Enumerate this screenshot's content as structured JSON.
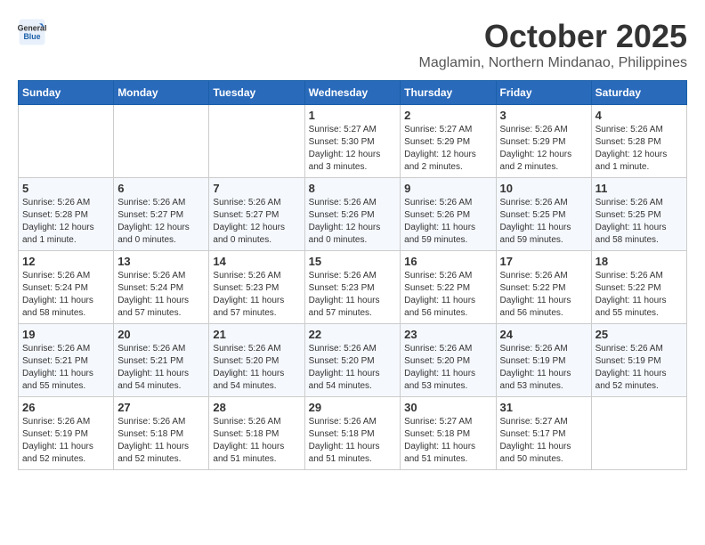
{
  "header": {
    "logo_line1": "General",
    "logo_line2": "Blue",
    "month": "October 2025",
    "location": "Maglamin, Northern Mindanao, Philippines"
  },
  "weekdays": [
    "Sunday",
    "Monday",
    "Tuesday",
    "Wednesday",
    "Thursday",
    "Friday",
    "Saturday"
  ],
  "weeks": [
    [
      {
        "day": "",
        "sunrise": "",
        "sunset": "",
        "daylight": ""
      },
      {
        "day": "",
        "sunrise": "",
        "sunset": "",
        "daylight": ""
      },
      {
        "day": "",
        "sunrise": "",
        "sunset": "",
        "daylight": ""
      },
      {
        "day": "1",
        "sunrise": "Sunrise: 5:27 AM",
        "sunset": "Sunset: 5:30 PM",
        "daylight": "Daylight: 12 hours and 3 minutes."
      },
      {
        "day": "2",
        "sunrise": "Sunrise: 5:27 AM",
        "sunset": "Sunset: 5:29 PM",
        "daylight": "Daylight: 12 hours and 2 minutes."
      },
      {
        "day": "3",
        "sunrise": "Sunrise: 5:26 AM",
        "sunset": "Sunset: 5:29 PM",
        "daylight": "Daylight: 12 hours and 2 minutes."
      },
      {
        "day": "4",
        "sunrise": "Sunrise: 5:26 AM",
        "sunset": "Sunset: 5:28 PM",
        "daylight": "Daylight: 12 hours and 1 minute."
      }
    ],
    [
      {
        "day": "5",
        "sunrise": "Sunrise: 5:26 AM",
        "sunset": "Sunset: 5:28 PM",
        "daylight": "Daylight: 12 hours and 1 minute."
      },
      {
        "day": "6",
        "sunrise": "Sunrise: 5:26 AM",
        "sunset": "Sunset: 5:27 PM",
        "daylight": "Daylight: 12 hours and 0 minutes."
      },
      {
        "day": "7",
        "sunrise": "Sunrise: 5:26 AM",
        "sunset": "Sunset: 5:27 PM",
        "daylight": "Daylight: 12 hours and 0 minutes."
      },
      {
        "day": "8",
        "sunrise": "Sunrise: 5:26 AM",
        "sunset": "Sunset: 5:26 PM",
        "daylight": "Daylight: 12 hours and 0 minutes."
      },
      {
        "day": "9",
        "sunrise": "Sunrise: 5:26 AM",
        "sunset": "Sunset: 5:26 PM",
        "daylight": "Daylight: 11 hours and 59 minutes."
      },
      {
        "day": "10",
        "sunrise": "Sunrise: 5:26 AM",
        "sunset": "Sunset: 5:25 PM",
        "daylight": "Daylight: 11 hours and 59 minutes."
      },
      {
        "day": "11",
        "sunrise": "Sunrise: 5:26 AM",
        "sunset": "Sunset: 5:25 PM",
        "daylight": "Daylight: 11 hours and 58 minutes."
      }
    ],
    [
      {
        "day": "12",
        "sunrise": "Sunrise: 5:26 AM",
        "sunset": "Sunset: 5:24 PM",
        "daylight": "Daylight: 11 hours and 58 minutes."
      },
      {
        "day": "13",
        "sunrise": "Sunrise: 5:26 AM",
        "sunset": "Sunset: 5:24 PM",
        "daylight": "Daylight: 11 hours and 57 minutes."
      },
      {
        "day": "14",
        "sunrise": "Sunrise: 5:26 AM",
        "sunset": "Sunset: 5:23 PM",
        "daylight": "Daylight: 11 hours and 57 minutes."
      },
      {
        "day": "15",
        "sunrise": "Sunrise: 5:26 AM",
        "sunset": "Sunset: 5:23 PM",
        "daylight": "Daylight: 11 hours and 57 minutes."
      },
      {
        "day": "16",
        "sunrise": "Sunrise: 5:26 AM",
        "sunset": "Sunset: 5:22 PM",
        "daylight": "Daylight: 11 hours and 56 minutes."
      },
      {
        "day": "17",
        "sunrise": "Sunrise: 5:26 AM",
        "sunset": "Sunset: 5:22 PM",
        "daylight": "Daylight: 11 hours and 56 minutes."
      },
      {
        "day": "18",
        "sunrise": "Sunrise: 5:26 AM",
        "sunset": "Sunset: 5:22 PM",
        "daylight": "Daylight: 11 hours and 55 minutes."
      }
    ],
    [
      {
        "day": "19",
        "sunrise": "Sunrise: 5:26 AM",
        "sunset": "Sunset: 5:21 PM",
        "daylight": "Daylight: 11 hours and 55 minutes."
      },
      {
        "day": "20",
        "sunrise": "Sunrise: 5:26 AM",
        "sunset": "Sunset: 5:21 PM",
        "daylight": "Daylight: 11 hours and 54 minutes."
      },
      {
        "day": "21",
        "sunrise": "Sunrise: 5:26 AM",
        "sunset": "Sunset: 5:20 PM",
        "daylight": "Daylight: 11 hours and 54 minutes."
      },
      {
        "day": "22",
        "sunrise": "Sunrise: 5:26 AM",
        "sunset": "Sunset: 5:20 PM",
        "daylight": "Daylight: 11 hours and 54 minutes."
      },
      {
        "day": "23",
        "sunrise": "Sunrise: 5:26 AM",
        "sunset": "Sunset: 5:20 PM",
        "daylight": "Daylight: 11 hours and 53 minutes."
      },
      {
        "day": "24",
        "sunrise": "Sunrise: 5:26 AM",
        "sunset": "Sunset: 5:19 PM",
        "daylight": "Daylight: 11 hours and 53 minutes."
      },
      {
        "day": "25",
        "sunrise": "Sunrise: 5:26 AM",
        "sunset": "Sunset: 5:19 PM",
        "daylight": "Daylight: 11 hours and 52 minutes."
      }
    ],
    [
      {
        "day": "26",
        "sunrise": "Sunrise: 5:26 AM",
        "sunset": "Sunset: 5:19 PM",
        "daylight": "Daylight: 11 hours and 52 minutes."
      },
      {
        "day": "27",
        "sunrise": "Sunrise: 5:26 AM",
        "sunset": "Sunset: 5:18 PM",
        "daylight": "Daylight: 11 hours and 52 minutes."
      },
      {
        "day": "28",
        "sunrise": "Sunrise: 5:26 AM",
        "sunset": "Sunset: 5:18 PM",
        "daylight": "Daylight: 11 hours and 51 minutes."
      },
      {
        "day": "29",
        "sunrise": "Sunrise: 5:26 AM",
        "sunset": "Sunset: 5:18 PM",
        "daylight": "Daylight: 11 hours and 51 minutes."
      },
      {
        "day": "30",
        "sunrise": "Sunrise: 5:27 AM",
        "sunset": "Sunset: 5:18 PM",
        "daylight": "Daylight: 11 hours and 51 minutes."
      },
      {
        "day": "31",
        "sunrise": "Sunrise: 5:27 AM",
        "sunset": "Sunset: 5:17 PM",
        "daylight": "Daylight: 11 hours and 50 minutes."
      },
      {
        "day": "",
        "sunrise": "",
        "sunset": "",
        "daylight": ""
      }
    ]
  ]
}
